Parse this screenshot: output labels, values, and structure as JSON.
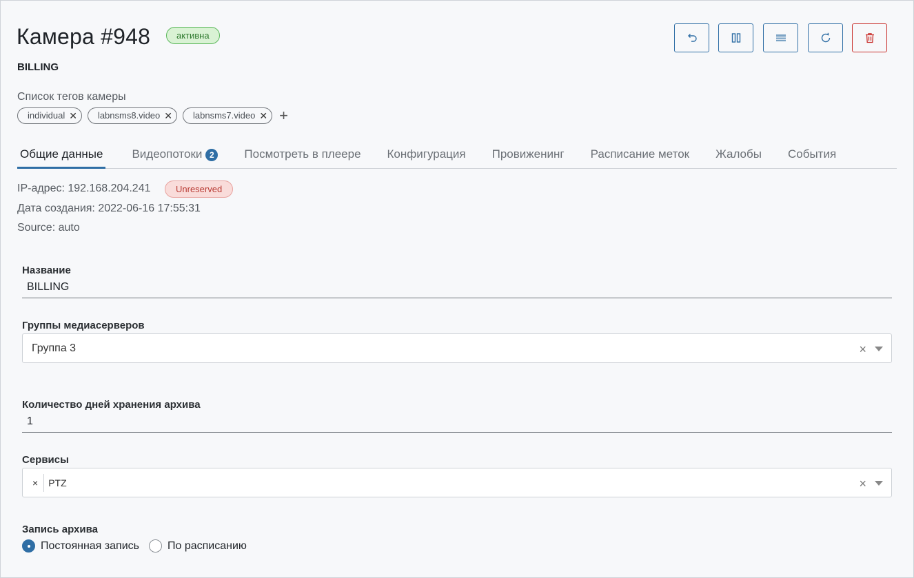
{
  "header": {
    "title": "Камера #948",
    "status": "активна",
    "subtitle": "BILLING"
  },
  "toolbar": {
    "icons": [
      "undo-icon",
      "pause-icon",
      "list-icon",
      "refresh-icon",
      "trash-icon"
    ],
    "danger_color": "#c9302c",
    "accent_color": "#2f6ea5"
  },
  "tags": {
    "label": "Список тегов камеры",
    "items": [
      "individual",
      "labnsms8.video",
      "labnsms7.video"
    ],
    "remove_glyph": "✕",
    "add_glyph": "+"
  },
  "tabs": [
    {
      "label": "Общие данные",
      "active": true
    },
    {
      "label": "Видеопотоки",
      "count": "2"
    },
    {
      "label": "Посмотреть в плеере"
    },
    {
      "label": "Конфигурация"
    },
    {
      "label": "Провиженинг"
    },
    {
      "label": "Расписание меток"
    },
    {
      "label": "Жалобы"
    },
    {
      "label": "События"
    }
  ],
  "info": {
    "ip": "IP-адрес: 192.168.204.241",
    "ip_status": "Unreserved",
    "created": "Дата создания: 2022-06-16 17:55:31",
    "source": "Source: auto"
  },
  "form": {
    "name_label": "Название",
    "name_value": "BILLING",
    "groups_label": "Группы медиасерверов",
    "groups_value": "Группа 3",
    "archive_days_label": "Количество дней хранения архива",
    "archive_days_value": "1",
    "services_label": "Сервисы",
    "services_value": "PTZ",
    "clear_glyph": "×",
    "archive_label": "Запись архива",
    "archive_options": [
      {
        "label": "Постоянная запись",
        "checked": true
      },
      {
        "label": "По расписанию",
        "checked": false
      }
    ]
  }
}
